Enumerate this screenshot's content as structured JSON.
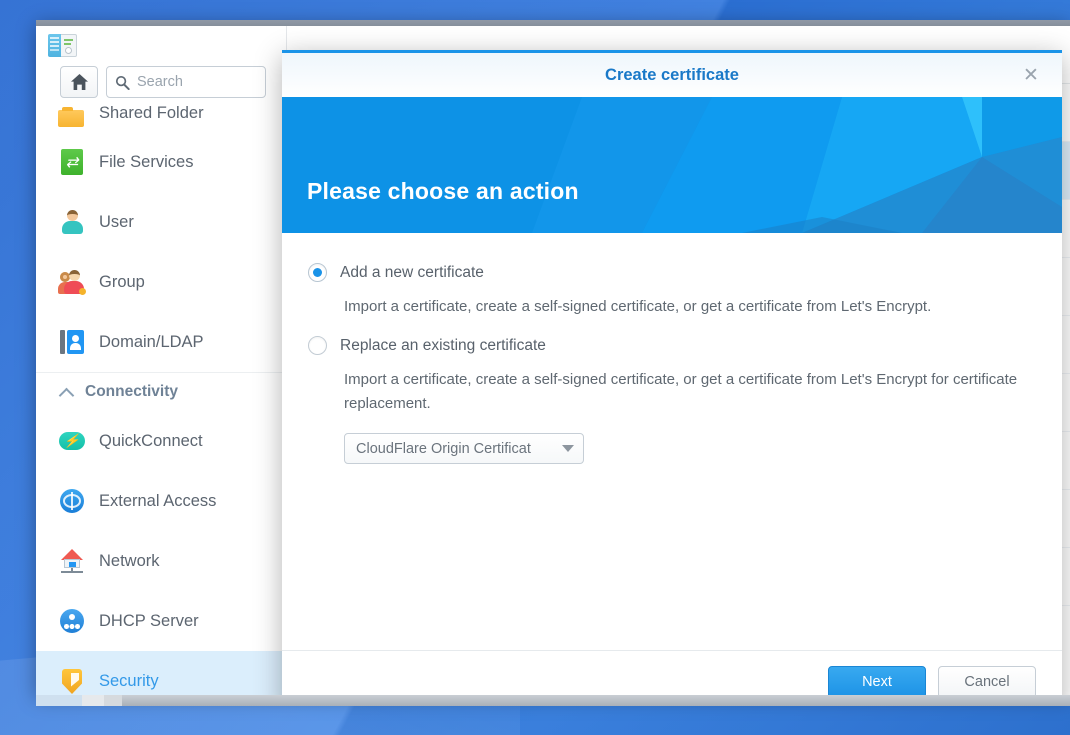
{
  "desktop": {
    "wallpaper_color": "#2a71da"
  },
  "app_window": {
    "icon_name": "dsm-control-panel-icon",
    "home_button_icon": "home-icon",
    "search": {
      "icon": "search-icon",
      "placeholder": "Search",
      "value": "Search"
    },
    "sidebar": {
      "items": [
        {
          "label": "Shared Folder",
          "icon": "shared-folder-icon",
          "selected": false,
          "clipped": true
        },
        {
          "label": "File Services",
          "icon": "file-services-icon",
          "selected": false
        },
        {
          "label": "User",
          "icon": "user-icon",
          "selected": false
        },
        {
          "label": "Group",
          "icon": "group-icon",
          "selected": false
        },
        {
          "label": "Domain/LDAP",
          "icon": "domain-ldap-icon",
          "selected": false
        }
      ],
      "section": {
        "label": "Connectivity",
        "chevron": "chevron-up-icon"
      },
      "connectivity_items": [
        {
          "label": "QuickConnect",
          "icon": "quickconnect-icon",
          "selected": false
        },
        {
          "label": "External Access",
          "icon": "external-access-globe-icon",
          "selected": false
        },
        {
          "label": "Network",
          "icon": "network-icon",
          "selected": false
        },
        {
          "label": "DHCP Server",
          "icon": "dhcp-server-icon",
          "selected": false
        },
        {
          "label": "Security",
          "icon": "security-shield-icon",
          "selected": true
        }
      ]
    }
  },
  "dialog": {
    "title": "Create certificate",
    "close_icon": "close-icon",
    "banner_title": "Please choose an action",
    "banner_color": "#0d92e6",
    "accent_color": "#1a93e8",
    "options": [
      {
        "id": "add-new-certificate",
        "label": "Add a new certificate",
        "selected": true,
        "description": "Import a certificate, create a self-signed certificate, or get a certificate from Let's Encrypt."
      },
      {
        "id": "replace-existing-certificate",
        "label": "Replace an existing certificate",
        "selected": false,
        "description": "Import a certificate, create a self-signed certificate, or get a certificate from Let's Encrypt for certificate replacement."
      }
    ],
    "certificate_select": {
      "value": "CloudFlare Origin Certificat",
      "caret_icon": "chevron-down-icon"
    },
    "buttons": {
      "next": "Next",
      "cancel": "Cancel"
    }
  }
}
